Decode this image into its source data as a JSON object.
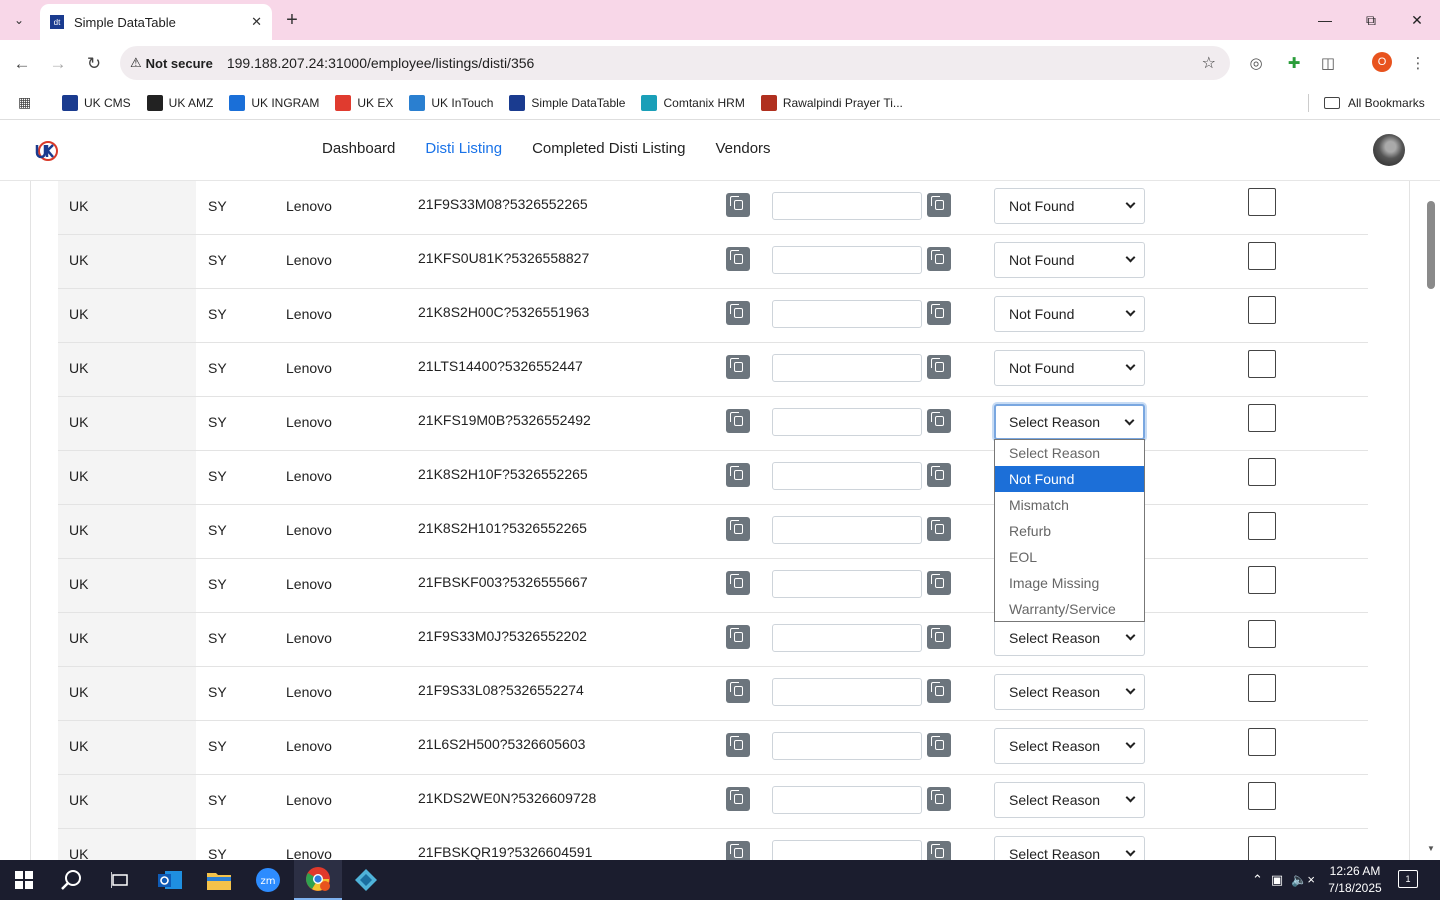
{
  "browser": {
    "tab_title": "Simple DataTable",
    "security_label": "Not secure",
    "url": "199.188.207.24:31000/employee/listings/disti/356",
    "profile_initial": "O",
    "bookmarks": [
      {
        "label": "UK CMS",
        "icon": "uk-cms-icon",
        "color": "#1a3b8f"
      },
      {
        "label": "UK AMZ",
        "icon": "amazon-icon",
        "color": "#222222"
      },
      {
        "label": "UK INGRAM",
        "icon": "ingram-icon",
        "color": "#1a6fd8"
      },
      {
        "label": "UK EX",
        "icon": "ex-icon",
        "color": "#e03b2f"
      },
      {
        "label": "UK InTouch",
        "icon": "intouch-icon",
        "color": "#2a7fd0"
      },
      {
        "label": "Simple DataTable",
        "icon": "datatable-icon",
        "color": "#1a3b8f"
      },
      {
        "label": "Comtanix HRM",
        "icon": "hrm-icon",
        "color": "#1a9fb8"
      },
      {
        "label": "Rawalpindi Prayer Ti...",
        "icon": "mosque-icon",
        "color": "#b0301f"
      }
    ],
    "all_bookmarks_label": "All Bookmarks"
  },
  "nav": {
    "links": [
      "Dashboard",
      "Disti Listing",
      "Completed Disti Listing",
      "Vendors"
    ],
    "active_index": 1
  },
  "table": {
    "rows": [
      {
        "region": "UK",
        "code": "SY",
        "brand": "Lenovo",
        "sku": "21F9S33M08?5326552265",
        "reason": "Not Found"
      },
      {
        "region": "UK",
        "code": "SY",
        "brand": "Lenovo",
        "sku": "21KFS0U81K?5326558827",
        "reason": "Not Found"
      },
      {
        "region": "UK",
        "code": "SY",
        "brand": "Lenovo",
        "sku": "21K8S2H00C?5326551963",
        "reason": "Not Found"
      },
      {
        "region": "UK",
        "code": "SY",
        "brand": "Lenovo",
        "sku": "21LTS14400?5326552447",
        "reason": "Not Found"
      },
      {
        "region": "UK",
        "code": "SY",
        "brand": "Lenovo",
        "sku": "21KFS19M0B?5326552492",
        "reason": "Select Reason"
      },
      {
        "region": "UK",
        "code": "SY",
        "brand": "Lenovo",
        "sku": "21K8S2H10F?5326552265",
        "reason": ""
      },
      {
        "region": "UK",
        "code": "SY",
        "brand": "Lenovo",
        "sku": "21K8S2H101?5326552265",
        "reason": ""
      },
      {
        "region": "UK",
        "code": "SY",
        "brand": "Lenovo",
        "sku": "21FBSKF003?5326555667",
        "reason": ""
      },
      {
        "region": "UK",
        "code": "SY",
        "brand": "Lenovo",
        "sku": "21F9S33M0J?5326552202",
        "reason": "Select Reason"
      },
      {
        "region": "UK",
        "code": "SY",
        "brand": "Lenovo",
        "sku": "21F9S33L08?5326552274",
        "reason": "Select Reason"
      },
      {
        "region": "UK",
        "code": "SY",
        "brand": "Lenovo",
        "sku": "21L6S2H500?5326605603",
        "reason": "Select Reason"
      },
      {
        "region": "UK",
        "code": "SY",
        "brand": "Lenovo",
        "sku": "21KDS2WE0N?5326609728",
        "reason": "Select Reason"
      },
      {
        "region": "UK",
        "code": "SY",
        "brand": "Lenovo",
        "sku": "21FBSKQR19?5326604591",
        "reason": "Select Reason"
      }
    ]
  },
  "dropdown": {
    "options": [
      "Select Reason",
      "Not Found",
      "Mismatch",
      "Refurb",
      "EOL",
      "Image Missing",
      "Warranty/Service"
    ],
    "highlighted_index": 1
  },
  "taskbar": {
    "time": "12:26 AM",
    "date": "7/18/2025",
    "notification_count": "1",
    "apps": [
      "start-icon",
      "search-icon",
      "task-view-icon",
      "outlook-icon",
      "file-explorer-icon",
      "zoom-icon",
      "chrome-icon",
      "app-icon"
    ]
  },
  "colors": {
    "accent": "#1a73e8",
    "select_highlight": "#1c6fd8",
    "copy_button": "#6c757d",
    "titlebar": "#f8d7e8"
  }
}
